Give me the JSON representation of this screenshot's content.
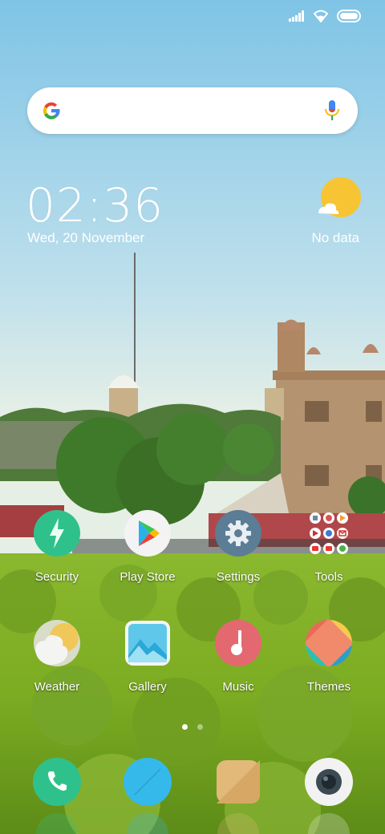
{
  "home": {
    "clock": {
      "time": "02:36",
      "date": "Wed, 20 November"
    },
    "weather_widget": {
      "status": "No data",
      "icon": "sun-cloud-icon"
    },
    "search": {
      "icon": "google-g-icon",
      "voice_icon": "microphone-icon"
    }
  },
  "status_bar": {
    "icons": [
      "signal-icon",
      "wifi-icon",
      "battery-icon"
    ]
  },
  "apps": [
    {
      "label": "Security",
      "icon": "security-icon",
      "color": "#2fc18c"
    },
    {
      "label": "Play Store",
      "icon": "play-store-icon",
      "color": "#ffffff"
    },
    {
      "label": "Settings",
      "icon": "settings-gear-icon",
      "color": "#5b7d95"
    },
    {
      "label": "Tools",
      "icon": "tools-folder-icon",
      "color": "#ffffff"
    },
    {
      "label": "Weather",
      "icon": "weather-icon",
      "color": "#f0d070"
    },
    {
      "label": "Gallery",
      "icon": "gallery-icon",
      "color": "#5fc8ea"
    },
    {
      "label": "Music",
      "icon": "music-icon",
      "color": "#e46870"
    },
    {
      "label": "Themes",
      "icon": "themes-icon",
      "color": "#f08a6a"
    }
  ],
  "dock": [
    {
      "icon": "phone-icon",
      "color": "#2fc18c"
    },
    {
      "icon": "messages-icon",
      "color": "#35b9ea"
    },
    {
      "icon": "browser-icon",
      "color": "#e3b97a"
    },
    {
      "icon": "camera-icon",
      "color": "#f2f2f2"
    }
  ],
  "page_indicator": {
    "current": 1,
    "total": 2
  }
}
